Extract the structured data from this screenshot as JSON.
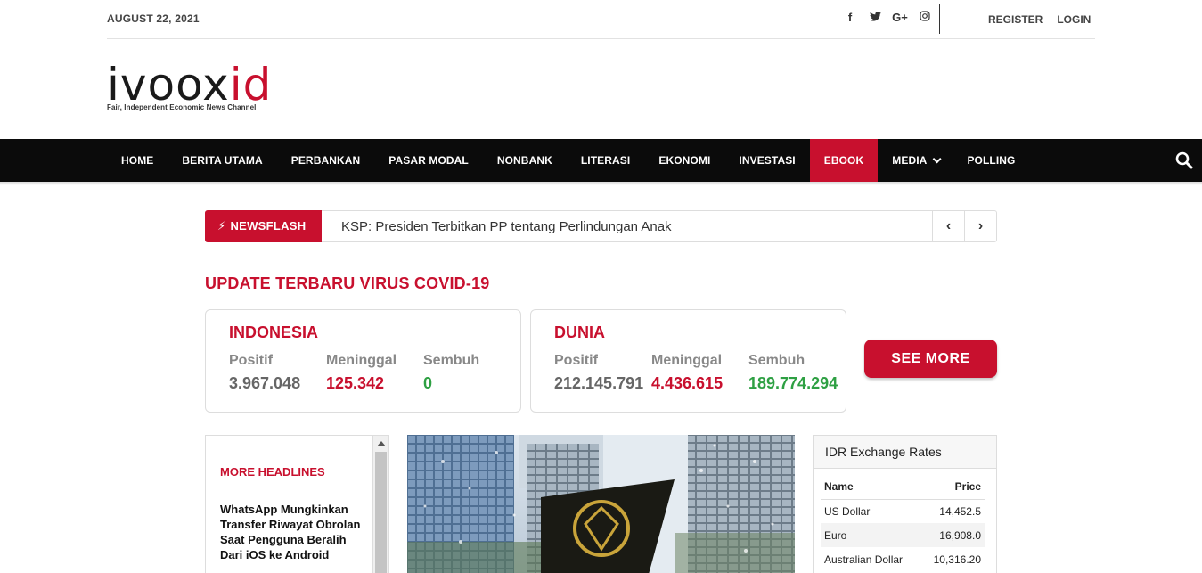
{
  "topbar": {
    "date": "AUGUST 22, 2021",
    "social_icons": [
      "facebook-icon",
      "twitter-icon",
      "google-plus-icon",
      "instagram-icon"
    ],
    "register": "REGISTER",
    "login": "LOGIN"
  },
  "logo": {
    "word_main": "ivoox",
    "word_accent": "id",
    "tagline": "Fair, Independent Economic News Channel"
  },
  "nav": {
    "items": [
      "HOME",
      "BERITA UTAMA",
      "PERBANKAN",
      "PASAR MODAL",
      "NONBANK",
      "LITERASI",
      "EKONOMI",
      "INVESTASI",
      "EBOOK",
      "MEDIA",
      "POLLING"
    ],
    "active": "EBOOK"
  },
  "newsflash": {
    "label": "NEWSFLASH",
    "text": "KSP: Presiden Terbitkan PP tentang Perlindungan Anak"
  },
  "covid": {
    "title": "UPDATE TERBARU VIRUS COVID-19",
    "indonesia": {
      "name": "INDONESIA",
      "positif_label": "Positif",
      "positif": "3.967.048",
      "meninggal_label": "Meninggal",
      "meninggal": "125.342",
      "sembuh_label": "Sembuh",
      "sembuh": "0"
    },
    "dunia": {
      "name": "DUNIA",
      "positif_label": "Positif",
      "positif": "212.145.791",
      "meninggal_label": "Meninggal",
      "meninggal": "4.436.615",
      "sembuh_label": "Sembuh",
      "sembuh": "189.774.294"
    },
    "see_more": "SEE MORE"
  },
  "headlines": {
    "title": "MORE HEADLINES",
    "first_item": "WhatsApp Mungkinkan Transfer Riwayat Obrolan Saat Pengguna Beralih Dari iOS ke Android"
  },
  "exchange": {
    "title": "IDR Exchange Rates",
    "col_name": "Name",
    "col_price": "Price",
    "rows": [
      {
        "name": "US Dollar",
        "price": "14,452.5"
      },
      {
        "name": "Euro",
        "price": "16,908.0"
      },
      {
        "name": "Australian Dollar",
        "price": "10,316.20"
      }
    ]
  },
  "colors": {
    "accent": "#c8102e",
    "nav_bg": "#0b0b0b",
    "positive_green": "#2ea043"
  }
}
